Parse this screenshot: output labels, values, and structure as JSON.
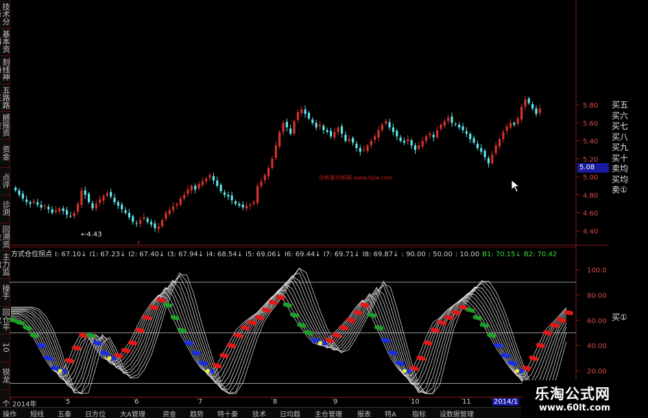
{
  "sidebar": {
    "tabs": [
      "技术分析",
      "基本资料",
      "刻线神特",
      "五路路王",
      "撼摇资金",
      "资金",
      "点评",
      "诊测",
      "回溯资金",
      "主力监盘",
      "操手",
      "回仓平龙",
      "10",
      "锐龙",
      "个"
    ]
  },
  "price_chart": {
    "y_ticks": [
      "5.80",
      "5.60",
      "5.40",
      "5.20",
      "5.00",
      "4.80",
      "4.60",
      "4.40"
    ],
    "current_price": "5.08",
    "low_marker": "←4.43",
    "watermark": "分析家分析网 www.fxjw.com",
    "right_labels": [
      "买五",
      "买六",
      "买七",
      "买八",
      "买九",
      "买十",
      "卖均",
      "买均",
      "卖①"
    ],
    "colors": {
      "up": "#d8322e",
      "down": "#5fe6ea"
    }
  },
  "indicator": {
    "title": "方式仓位拐点",
    "items": [
      "I: 67.10",
      "I1: 67.23",
      "I2: 67.40",
      "I3: 67.94",
      "I4: 68.54",
      "I5: 69.06",
      "I6: 69.44",
      "I7: 69.71",
      "I8: 69.87",
      ": 90.00",
      ": 50.00",
      ": 10.00"
    ],
    "arrow": "↓",
    "b1": "B1: 70.15",
    "b2": "B2: 70.42",
    "y_ticks": [
      "100.0",
      "80.00",
      "60.00",
      "40.00",
      "20.00"
    ],
    "right_label": "买①",
    "ref_lines": [
      90,
      50,
      10
    ],
    "colors": {
      "fan": "#ffffff",
      "red": "#e01818",
      "blue": "#1a2fe0",
      "green": "#1f9e2a",
      "yellow": "#f0f020"
    }
  },
  "axis": {
    "dates": [
      "2014年",
      "5",
      "6",
      "7",
      "8",
      "9",
      "10",
      "11",
      "2014/1"
    ]
  },
  "bottom_tabs": [
    "操作",
    "短线",
    "五秦",
    "日方位",
    "大A管理",
    "资金",
    "趋势",
    "特十秦",
    "技术",
    "日均趋",
    "主仓管理",
    "报表",
    "特A",
    "指标",
    "设数据管理"
  ],
  "ad": {
    "title": "乐淘公式网",
    "url": "www.60lt.com"
  },
  "chart_data": [
    {
      "type": "candlestick",
      "title": "",
      "ylim": [
        4.3,
        5.9
      ],
      "y_ticks": [
        4.4,
        4.6,
        4.8,
        5.0,
        5.2,
        5.4,
        5.6,
        5.8
      ],
      "close": [
        4.85,
        4.8,
        4.76,
        4.72,
        4.7,
        4.73,
        4.69,
        4.66,
        4.68,
        4.64,
        4.6,
        4.63,
        4.65,
        4.62,
        4.58,
        4.56,
        4.6,
        4.7,
        4.85,
        4.8,
        4.72,
        4.65,
        4.7,
        4.75,
        4.79,
        4.82,
        4.78,
        4.72,
        4.68,
        4.64,
        4.6,
        4.55,
        4.5,
        4.48,
        4.52,
        4.55,
        4.5,
        4.47,
        4.43,
        4.45,
        4.52,
        4.6,
        4.63,
        4.67,
        4.7,
        4.76,
        4.8,
        4.86,
        4.9,
        4.86,
        4.92,
        4.95,
        4.98,
        5.02,
        4.96,
        4.9,
        4.84,
        4.8,
        4.78,
        4.74,
        4.7,
        4.68,
        4.66,
        4.68,
        4.69,
        4.72,
        4.9,
        4.95,
        5.02,
        5.1,
        5.2,
        5.35,
        5.5,
        5.6,
        5.55,
        5.48,
        5.62,
        5.72,
        5.75,
        5.7,
        5.65,
        5.6,
        5.55,
        5.58,
        5.52,
        5.5,
        5.45,
        5.5,
        5.55,
        5.48,
        5.4,
        5.42,
        5.38,
        5.32,
        5.28,
        5.3,
        5.35,
        5.4,
        5.45,
        5.52,
        5.58,
        5.62,
        5.55,
        5.5,
        5.45,
        5.4,
        5.38,
        5.42,
        5.35,
        5.3,
        5.35,
        5.4,
        5.45,
        5.48,
        5.44,
        5.52,
        5.58,
        5.62,
        5.66,
        5.6,
        5.58,
        5.55,
        5.52,
        5.48,
        5.42,
        5.38,
        5.32,
        5.28,
        5.22,
        5.15,
        5.25,
        5.35,
        5.42,
        5.5,
        5.56,
        5.6,
        5.58,
        5.65,
        5.78,
        5.86,
        5.82,
        5.76,
        5.7,
        5.76
      ]
    },
    {
      "type": "line",
      "title": "方式仓位拐点",
      "ylim": [
        0,
        110
      ],
      "series": [
        {
          "name": "I",
          "values": [
            62,
            60,
            55,
            48,
            38,
            28,
            20,
            18,
            26,
            40,
            50,
            46,
            38,
            30,
            28,
            30,
            36,
            44,
            56,
            66,
            74,
            80,
            74,
            62,
            50,
            40,
            30,
            22,
            18,
            22,
            32,
            42,
            52,
            58,
            62,
            66,
            72,
            78,
            82,
            74,
            64,
            56,
            48,
            42,
            40,
            44,
            50,
            56,
            62,
            70,
            76,
            66,
            54,
            42,
            30,
            22,
            16,
            20,
            32,
            46,
            58,
            62,
            68,
            72,
            76,
            72,
            66,
            58,
            48,
            38,
            30,
            22,
            16,
            18,
            28,
            40,
            52,
            58,
            64,
            70
          ]
        },
        {
          "name": "B1",
          "values": [
            60,
            58,
            54,
            48,
            40,
            30,
            22,
            20,
            28,
            38,
            48,
            48,
            42,
            34,
            30,
            32,
            36,
            42,
            52,
            62,
            70,
            76,
            72,
            62,
            52,
            42,
            34,
            26,
            20,
            24,
            32,
            40,
            48,
            54,
            58,
            62,
            68,
            74,
            78,
            72,
            64,
            56,
            50,
            44,
            42,
            44,
            48,
            54,
            60,
            66,
            72,
            64,
            54,
            44,
            34,
            26,
            20,
            22,
            30,
            42,
            52,
            58,
            62,
            66,
            70,
            68,
            62,
            56,
            48,
            40,
            32,
            26,
            20,
            22,
            30,
            40,
            50,
            56,
            60,
            66
          ]
        }
      ],
      "reference_lines": [
        90,
        50,
        10
      ]
    }
  ]
}
